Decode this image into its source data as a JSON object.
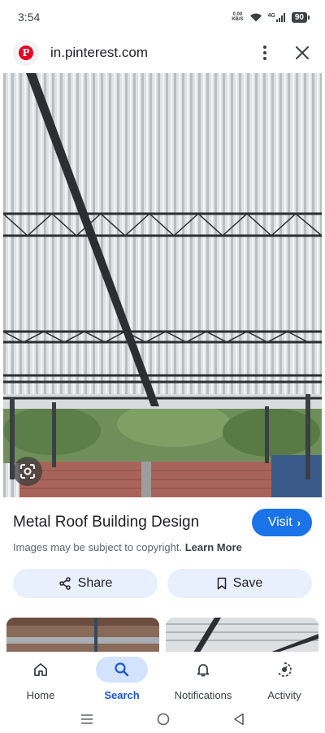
{
  "status_bar": {
    "time": "3:54",
    "net_speed_value": "0.00",
    "net_speed_unit": "KB/S",
    "network_type": "4G",
    "battery": "90"
  },
  "browser": {
    "url": "in.pinterest.com",
    "favicon_letter": "P"
  },
  "result": {
    "title": "Metal Roof Building Design",
    "visit_label": "Visit",
    "copyright_text": "Images may be subject to copyright.",
    "learn_more": "Learn More",
    "share_label": "Share",
    "save_label": "Save"
  },
  "bottom_nav": {
    "items": [
      {
        "label": "Home",
        "icon": "home-icon",
        "active": false
      },
      {
        "label": "Search",
        "icon": "search-icon",
        "active": true
      },
      {
        "label": "Notifications",
        "icon": "bell-icon",
        "active": false
      },
      {
        "label": "Activity",
        "icon": "activity-icon",
        "active": false
      }
    ]
  },
  "colors": {
    "accent": "#1a73e8",
    "active_nav": "#1a57d6",
    "chip_bg": "#e8f0fe"
  }
}
